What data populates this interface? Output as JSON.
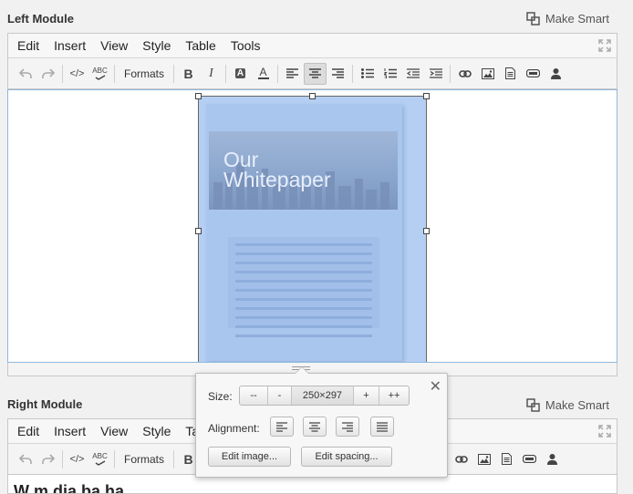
{
  "modules": {
    "left": {
      "title": "Left Module",
      "make_smart": "Make Smart"
    },
    "right": {
      "title": "Right Module",
      "make_smart": "Make Smart",
      "content_preview": "W m dia ba ha"
    }
  },
  "menu": [
    "Edit",
    "Insert",
    "View",
    "Style",
    "Table",
    "Tools"
  ],
  "toolbar": {
    "formats_label": "Formats",
    "icons": [
      "undo-icon",
      "redo-icon",
      "source-code-icon",
      "spellcheck-icon",
      "bold-icon",
      "italic-icon",
      "highlight-icon",
      "text-color-icon",
      "align-left-icon",
      "align-center-icon",
      "align-right-icon",
      "bullet-list-icon",
      "numbered-list-icon",
      "outdent-icon",
      "indent-icon",
      "link-icon",
      "image-icon",
      "document-icon",
      "widget-icon",
      "person-icon"
    ],
    "spellcheck_glyph": "ABC",
    "bold_glyph": "B",
    "italic_glyph": "I",
    "highlight_glyph": "A",
    "text_color_glyph": "A",
    "source_glyph": "</>"
  },
  "document_image": {
    "title_line1": "Our",
    "title_line2": "Whitepaper"
  },
  "image_popup": {
    "size_label": "Size:",
    "size_buttons": [
      "--",
      "-",
      "250×297",
      "+",
      "++"
    ],
    "alignment_label": "Alignment:",
    "edit_image": "Edit image...",
    "edit_spacing": "Edit spacing...",
    "close": "✕"
  },
  "colors": {
    "selection": "#b5cff3",
    "content_border": "#8fb8de",
    "background": "#f1f1f1"
  }
}
